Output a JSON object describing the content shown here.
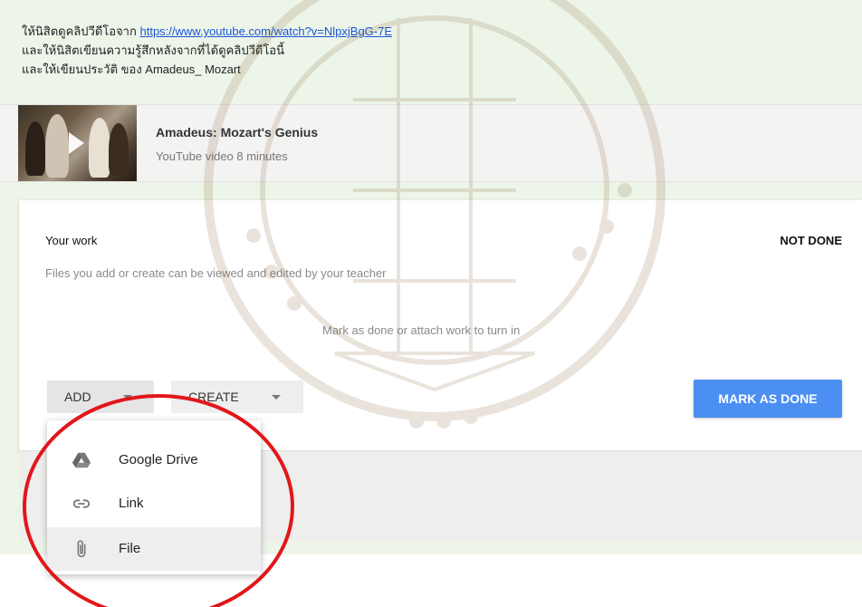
{
  "instructions": {
    "line1_prefix": "ให้นิสิตดูคลิปวีดีโอจาก",
    "line1_link": "https://www.youtube.com/watch?v=NlpxjBgG-7E",
    "line2": "และให้นิสิตเขียนความรู้สึกหลังจากที่ได้ดูคลิปวีดีโอนี้",
    "line3": "และให้เขียนประวัติ ของ Amadeus_ Mozart"
  },
  "attachment": {
    "title": "Amadeus: Mozart's Genius",
    "meta": "YouTube video  8 minutes"
  },
  "your_work": {
    "heading": "Your work",
    "status": "NOT DONE",
    "hint": "Files you add or create can be viewed and edited by your teacher",
    "turn_in_hint": "Mark as done or attach work to turn in",
    "add_label": "ADD",
    "create_label": "CREATE",
    "mark_done_label": "MARK AS DONE"
  },
  "add_menu": {
    "items": [
      {
        "label": "Google Drive",
        "icon": "google-drive-icon"
      },
      {
        "label": "Link",
        "icon": "link-icon"
      },
      {
        "label": "File",
        "icon": "paperclip-icon"
      }
    ]
  },
  "colors": {
    "panel_bg": "#edf5e9",
    "link": "#1a56d6",
    "primary_button": "#4c8ff2",
    "annotation_circle": "#e2161a"
  }
}
